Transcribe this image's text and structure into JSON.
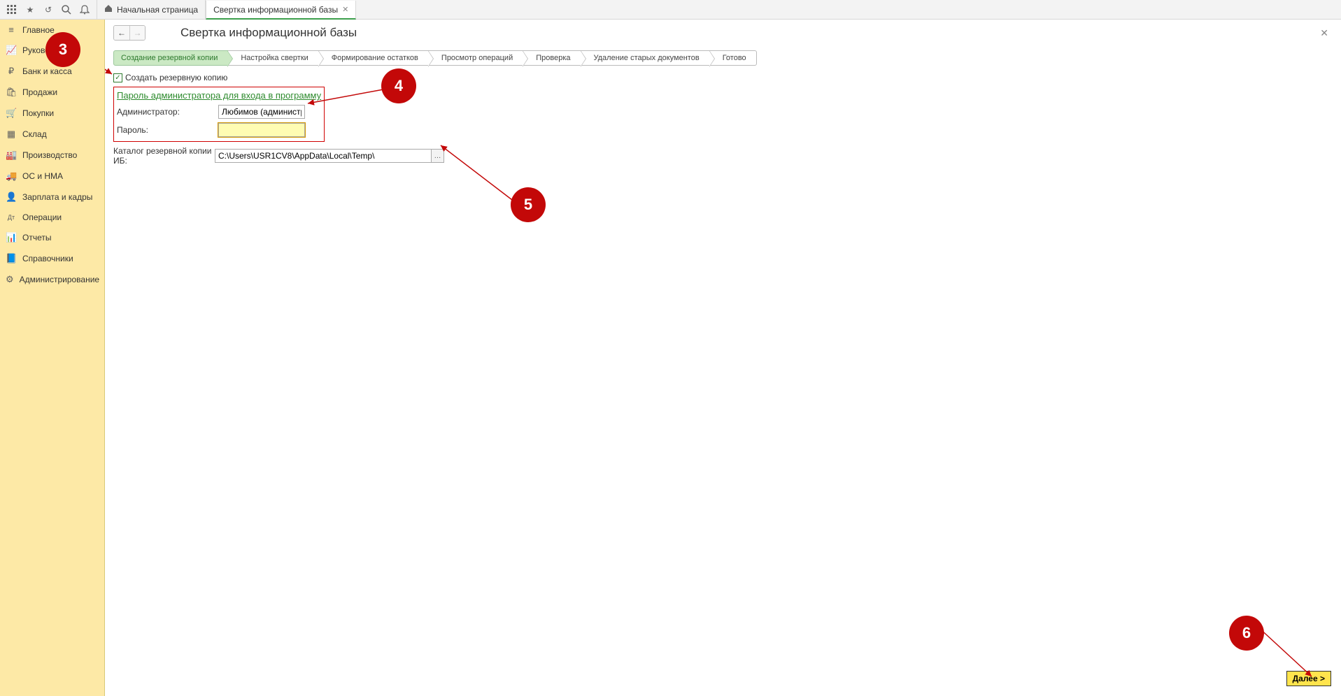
{
  "tabs": {
    "home": "Начальная страница",
    "active": "Свертка информационной базы"
  },
  "sidebar": {
    "items": [
      {
        "icon": "≡",
        "label": "Главное"
      },
      {
        "icon": "📈",
        "label": "Руководителю"
      },
      {
        "icon": "₽",
        "label": "Банк и касса"
      },
      {
        "icon": "🛍",
        "label": "Продажи"
      },
      {
        "icon": "🛒",
        "label": "Покупки"
      },
      {
        "icon": "▦",
        "label": "Склад"
      },
      {
        "icon": "🏭",
        "label": "Производство"
      },
      {
        "icon": "🚚",
        "label": "ОС и НМА"
      },
      {
        "icon": "👤",
        "label": "Зарплата и кадры"
      },
      {
        "icon": "Дт",
        "label": "Операции"
      },
      {
        "icon": "📊",
        "label": "Отчеты"
      },
      {
        "icon": "📘",
        "label": "Справочники"
      },
      {
        "icon": "⚙",
        "label": "Администрирование"
      }
    ]
  },
  "page": {
    "title": "Свертка информационной базы"
  },
  "wizard": {
    "steps": [
      "Создание резервной копии",
      "Настройка свертки",
      "Формирование остатков",
      "Просмотр операций",
      "Проверка",
      "Удаление старых документов",
      "Готово"
    ]
  },
  "form": {
    "create_backup_label": "Создать резервную копию",
    "section_title": "Пароль администратора для входа в программу",
    "admin_label": "Администратор:",
    "admin_value": "Любимов (администратор)",
    "password_label": "Пароль:",
    "password_value": "",
    "backup_path_label": "Каталог резервной копии ИБ:",
    "backup_path_value": "C:\\Users\\USR1CV8\\AppData\\Local\\Temp\\"
  },
  "footer": {
    "next": "Далее >"
  },
  "anno": {
    "b3": "3",
    "b4": "4",
    "b5": "5",
    "b6": "6"
  }
}
